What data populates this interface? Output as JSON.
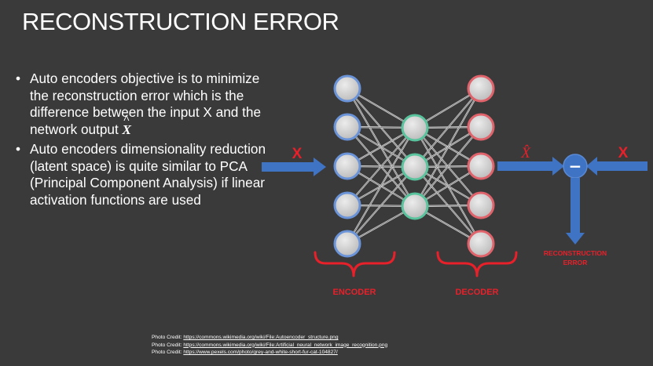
{
  "title": "RECONSTRUCTION ERROR",
  "bullets": [
    {
      "text": "Auto encoders objective is to minimize the reconstruction error which is the difference between the input X and the network output",
      "math": "X"
    },
    {
      "text": "Auto encoders dimensionality reduction (latent space) is quite similar to PCA (Principal Component Analysis) if linear activation functions are used"
    }
  ],
  "bullet_symbol": "•",
  "diagram": {
    "input_label": "X",
    "output_label": "X̂",
    "compare_label": "X",
    "minus_symbol": "−",
    "error_label_line1": "RECONSTRUCTION",
    "error_label_line2": "ERROR",
    "encoder_label": "ENCODER",
    "decoder_label": "DECODER"
  },
  "credits": [
    {
      "prefix": "Photo Credit: ",
      "url": "https://commons.wikimedia.org/wiki/File:Autoencoder_structure.png"
    },
    {
      "prefix": "Photo Credit: ",
      "url": "https://commons.wikimedia.org/wiki/File:Artificial_neural_network_image_recognition.png"
    },
    {
      "prefix": "Photo Credit: ",
      "url": "https://www.pexels.com/photo/grey-and-white-short-fur-cat-104827/"
    }
  ],
  "colors": {
    "background": "#3a3a3a",
    "arrow": "#3f73c4",
    "red_label": "#e8202a",
    "node_input": "#6a93d8",
    "node_latent": "#58c39c",
    "node_output": "#e0636b",
    "node_fill": "#d9d9d9"
  }
}
